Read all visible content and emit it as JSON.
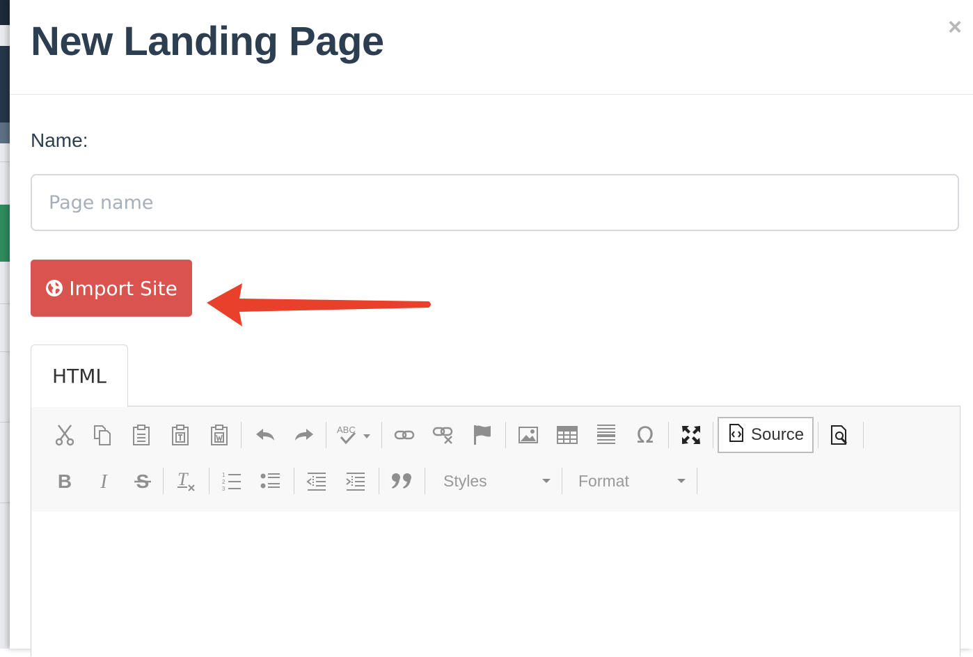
{
  "modal": {
    "title": "New Landing Page",
    "close_symbol": "×"
  },
  "form": {
    "name_label": "Name:",
    "name_placeholder": "Page name",
    "name_value": ""
  },
  "import_button": {
    "label": "Import Site",
    "icon": "globe-icon",
    "color": "#d9534f"
  },
  "annotation": {
    "arrow_color": "#e8402a",
    "arrow_icon": "left-arrow-annotation"
  },
  "editor": {
    "tabs": [
      "HTML"
    ],
    "toolbar_row1": [
      "cut-icon",
      "copy-icon",
      "paste-icon",
      "paste-text-icon",
      "paste-word-icon",
      "undo-icon",
      "redo-icon",
      "spellcheck-icon",
      "link-icon",
      "unlink-icon",
      "anchor-icon",
      "image-icon",
      "table-icon",
      "horizontal-rule-icon",
      "special-char-icon",
      "maximize-icon",
      "source-icon",
      "preview-icon"
    ],
    "toolbar_row2": [
      "bold-icon",
      "italic-icon",
      "strikethrough-icon",
      "remove-format-icon",
      "numbered-list-icon",
      "bulleted-list-icon",
      "outdent-icon",
      "indent-icon",
      "blockquote-icon"
    ],
    "source_label": "Source",
    "styles_label": "Styles",
    "format_label": "Format"
  }
}
